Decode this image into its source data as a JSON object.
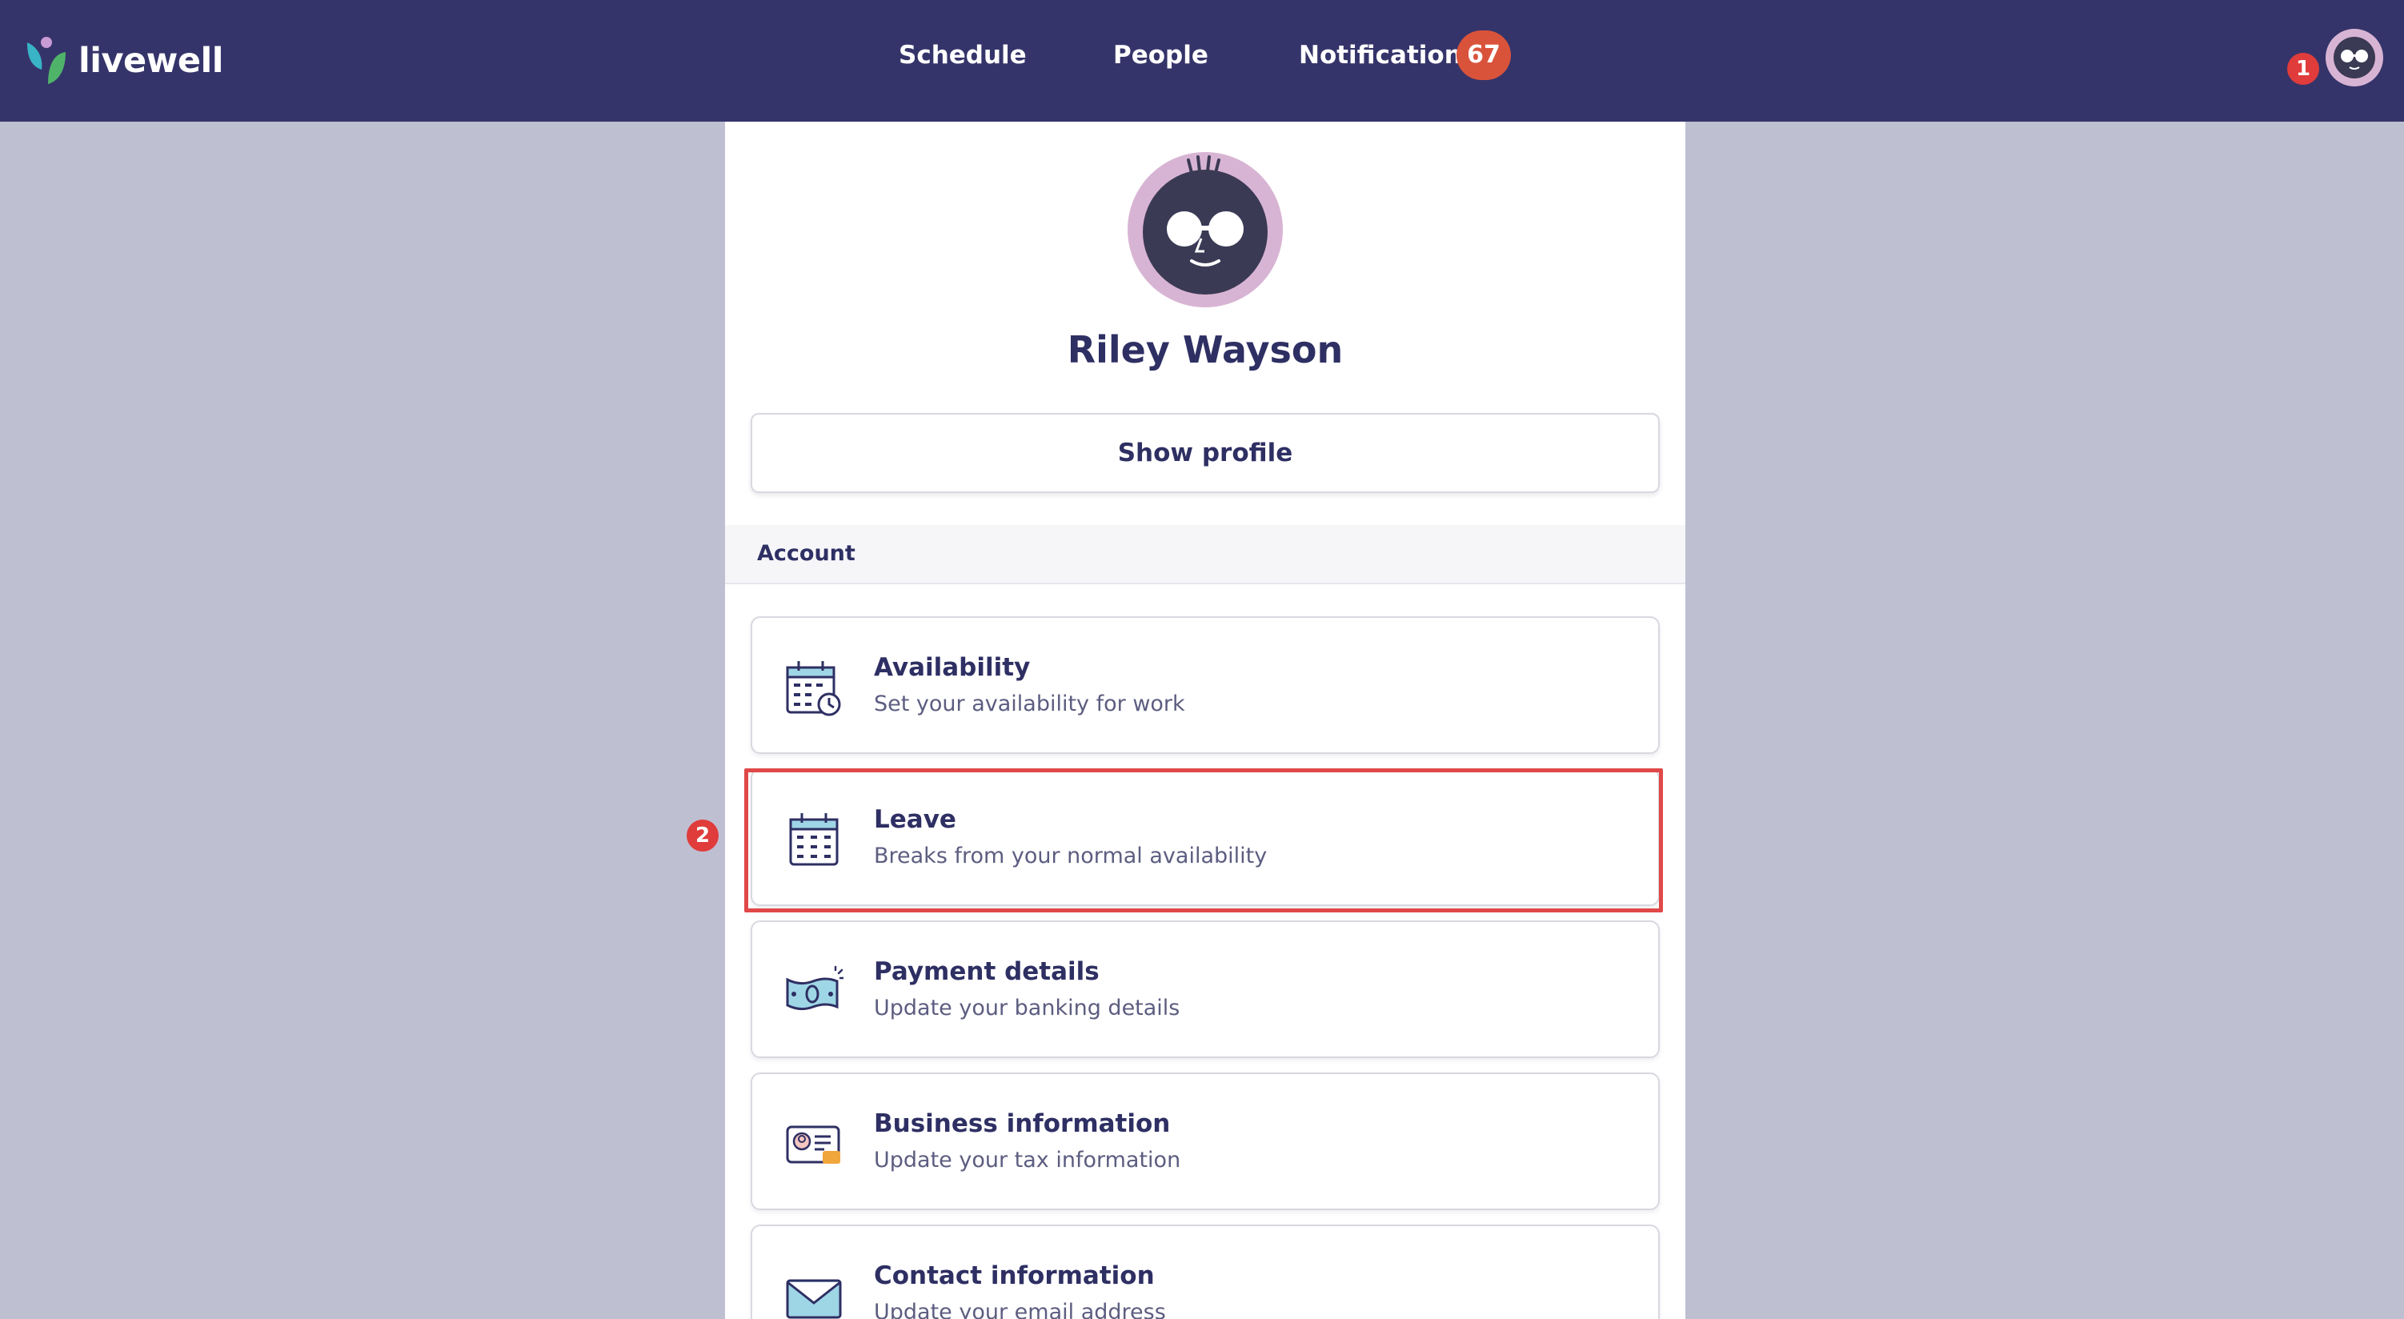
{
  "brand": {
    "name": "livewell"
  },
  "nav": {
    "items": [
      {
        "label": "Schedule"
      },
      {
        "label": "People"
      },
      {
        "label": "Notifications"
      }
    ],
    "notification_count": "67"
  },
  "markers": {
    "one": "1",
    "two": "2"
  },
  "profile": {
    "name": "Riley Wayson",
    "show_profile_label": "Show profile"
  },
  "account": {
    "section_title": "Account",
    "items": [
      {
        "title": "Availability",
        "subtitle": "Set your availability for work",
        "icon": "calendar-clock-icon"
      },
      {
        "title": "Leave",
        "subtitle": "Breaks from your normal availability",
        "icon": "calendar-icon"
      },
      {
        "title": "Payment details",
        "subtitle": "Update your banking details",
        "icon": "banknote-icon"
      },
      {
        "title": "Business information",
        "subtitle": "Update your tax information",
        "icon": "id-card-icon"
      },
      {
        "title": "Contact information",
        "subtitle": "Update your email address",
        "icon": "envelope-icon"
      }
    ]
  },
  "colors": {
    "topbar": "#35346a",
    "page_background": "#bfbfd2",
    "text_primary": "#2e2f63",
    "badge": "#d9533b",
    "highlight": "#e04848",
    "avatar_bg": "#d8b4d4"
  }
}
